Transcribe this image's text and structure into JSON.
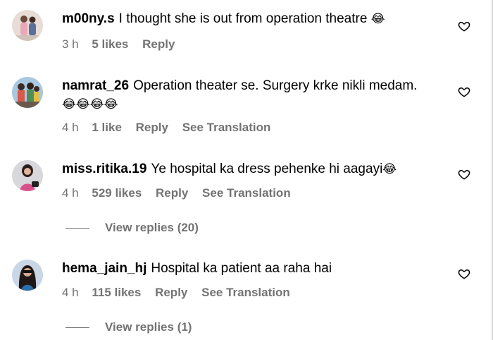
{
  "comments": [
    {
      "username": "m00ny.s",
      "text": "I thought she is out from operation theatre",
      "emoji": "😂",
      "time": "3 h",
      "likes": "5 likes",
      "reply": "Reply"
    },
    {
      "username": "namrat_26",
      "text": "Operation theater se. Surgery krke nikli medam.",
      "emoji": "😂😂😂😂",
      "time": "4 h",
      "likes": "1 like",
      "reply": "Reply",
      "translate": "See Translation"
    },
    {
      "username": "miss.ritika.19",
      "text": "Ye hospital ka dress pehenke hi aagayi",
      "emoji": "😂",
      "time": "4 h",
      "likes": "529 likes",
      "reply": "Reply",
      "translate": "See Translation",
      "view_replies": "View replies (20)"
    },
    {
      "username": "hema_jain_hj",
      "text": "Hospital ka patient aa raha hai",
      "time": "4 h",
      "likes": "115 likes",
      "reply": "Reply",
      "translate": "See Translation",
      "view_replies": "View replies (1)"
    }
  ],
  "icons": {
    "like": "heart-outline-icon"
  },
  "colors": {
    "text": "#000000",
    "secondary": "#737373",
    "background": "#ffffff"
  }
}
